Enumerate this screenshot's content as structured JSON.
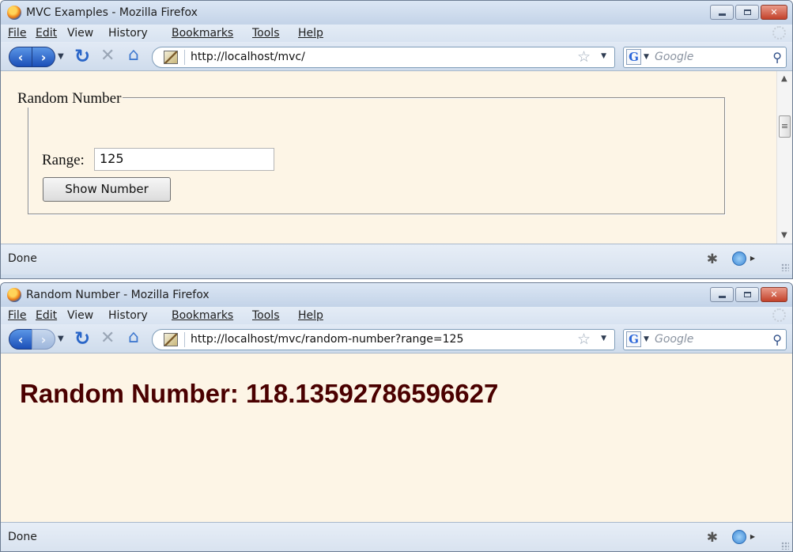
{
  "menu": [
    "File",
    "Edit",
    "View",
    "History",
    "Bookmarks",
    "Tools",
    "Help"
  ],
  "window1": {
    "title": "MVC Examples - Mozilla Firefox",
    "url": "http://localhost/mvc/",
    "search_placeholder": "Google",
    "legend": "Random Number",
    "range_label": "Range:",
    "range_value": "125",
    "button_label": "Show Number",
    "status": "Done"
  },
  "window2": {
    "title": "Random Number - Mozilla Firefox",
    "url": "http://localhost/mvc/random-number?range=125",
    "search_placeholder": "Google",
    "heading": "Random Number: 118.13592786596627",
    "status": "Done"
  },
  "icons": {
    "back": "back-arrow-icon",
    "forward": "forward-arrow-icon",
    "reload": "reload-icon",
    "stop": "stop-icon",
    "home": "home-icon",
    "bookmark": "star-icon",
    "search": "magnifier-icon"
  },
  "colors": {
    "page_background": "#fdf5e6",
    "heading": "#4a0000",
    "chrome": "#cfdcec"
  }
}
